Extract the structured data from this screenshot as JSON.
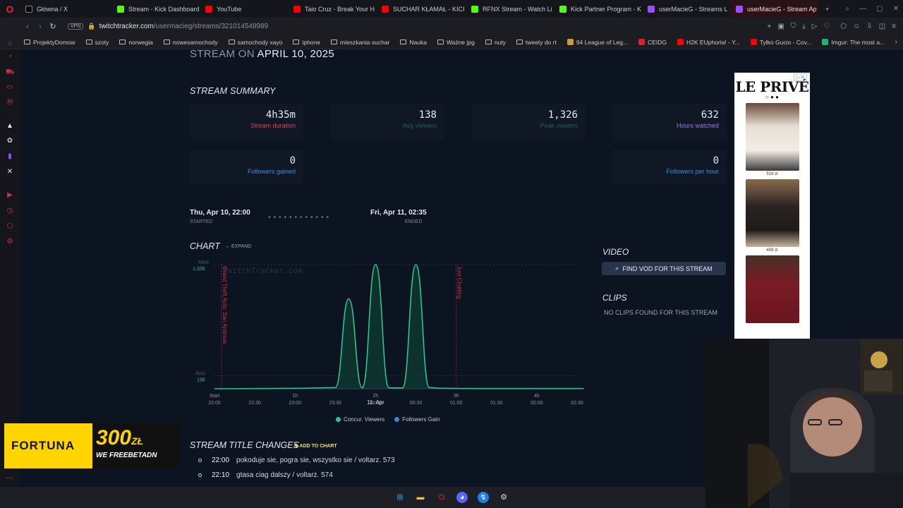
{
  "browser": {
    "tabs": [
      {
        "label": "Główna / X",
        "color": "#ffffff"
      },
      {
        "label": "Stream - Kick Dashboard",
        "color": "#53fc18"
      },
      {
        "label": "YouTube",
        "color": "#ff0000"
      },
      {
        "label": "Taio Cruz - Break Your H",
        "color": "#ff0000"
      },
      {
        "label": "SUCHAR KŁAMAŁ - KICI",
        "color": "#ff0000"
      },
      {
        "label": "RFNX Stream - Watch Li",
        "color": "#53fc18"
      },
      {
        "label": "Kick Partner Program - K",
        "color": "#53fc18"
      },
      {
        "label": "userMacieG - Streams L",
        "color": "#9b4dff"
      },
      {
        "label": "userMacieG - Stream Ap",
        "color": "#9b4dff"
      }
    ],
    "url_host": "twitchtracker.com",
    "url_path": "/usermacieg/streams/321014548989",
    "vpn_label": "VPN",
    "bookmarks": [
      {
        "label": "ProjektyDomow",
        "icon": "folder"
      },
      {
        "label": "szoty",
        "icon": "folder"
      },
      {
        "label": "norwegia",
        "icon": "folder"
      },
      {
        "label": "nowesamochody",
        "icon": "folder"
      },
      {
        "label": "samochody xayo",
        "icon": "folder"
      },
      {
        "label": "iphone",
        "icon": "folder"
      },
      {
        "label": "mieszkania suchar",
        "icon": "folder"
      },
      {
        "label": "Nauka",
        "icon": "folder"
      },
      {
        "label": "Ważne jpg",
        "icon": "folder"
      },
      {
        "label": "nuty",
        "icon": "folder"
      },
      {
        "label": "tweety do rt",
        "icon": "folder"
      },
      {
        "label": "94 League of Leg...",
        "icon": "site"
      },
      {
        "label": "CEIDG",
        "icon": "site"
      },
      {
        "label": "H2K EUphoria! - Y...",
        "icon": "site"
      },
      {
        "label": "Tylko Gucio - Cov...",
        "icon": "site"
      },
      {
        "label": "Imgur: The most a...",
        "icon": "site"
      }
    ]
  },
  "page": {
    "stream_on_prefix": "STREAM ON",
    "stream_on_date": "APRIL 10, 2025",
    "summary_title": "STREAM SUMMARY",
    "stats": [
      {
        "value": "4h35m",
        "label": "Stream duration",
        "color": "#e2434b"
      },
      {
        "value": "138",
        "label": "Avg viewers",
        "color": "#1f5f4a"
      },
      {
        "value": "1,326",
        "label": "Peak viewers",
        "color": "#1f5f4a"
      },
      {
        "value": "632",
        "label": "Hours watched",
        "color": "#9a7be0"
      },
      {
        "value": "0",
        "label": "Followers gained",
        "color": "#3b8fd6"
      },
      {
        "value": "0",
        "label": "Followers per hour",
        "color": "#3b8fd6"
      }
    ],
    "timeline": {
      "start": "Thu, Apr 10, 22:00",
      "start_label": "STARTED",
      "end": "Fri, Apr 11, 02:35",
      "end_label": "ENDED",
      "dots": "••••••••••••"
    },
    "chart_title": "CHART",
    "expand_label": "↔ EXPAND",
    "video_title": "VIDEO",
    "find_vod": "FIND VOD FOR THIS STREAM",
    "clips_title": "CLIPS",
    "no_clips": "NO CLIPS FOUND FOR THIS STREAM",
    "title_changes_title": "STREAM TITLE CHANGES",
    "add_to_chart": "✚ ADD TO CHART",
    "title_changes": [
      {
        "time": "22:00",
        "text": "pokoduje sie, pogra sie, wszystko sie / voltarz. 573"
      },
      {
        "time": "22:10",
        "text": "gtasa ciag dalszy / voltarz. 574"
      }
    ]
  },
  "chart_data": {
    "type": "line",
    "x_ticks": [
      "22:00",
      "22:30",
      "23:00",
      "23:30",
      "00:00",
      "00:30",
      "01:00",
      "01:30",
      "02:00",
      "02:30"
    ],
    "x_top_ticks": [
      "Start",
      "1h",
      "2h",
      "3h",
      "4h"
    ],
    "date_marker": "11. Apr",
    "max_label": "MAX",
    "max_value": 1326,
    "avg_label": "AVG",
    "avg_value": 138,
    "watermark": "TwitchTracker.com",
    "game_markers": [
      {
        "label": "Grand Theft Auto: San Andreas",
        "time": "22:00"
      },
      {
        "label": "Just Chatting",
        "time": "01:00"
      }
    ],
    "series": [
      {
        "name": "Concur. Viewers",
        "color": "#2fc38d",
        "x": [
          "22:00",
          "22:30",
          "23:00",
          "23:30",
          "23:40",
          "23:50",
          "00:00",
          "00:10",
          "00:20",
          "00:30",
          "00:40",
          "00:50",
          "01:00",
          "01:30",
          "02:00",
          "02:35"
        ],
        "values": [
          0,
          2,
          5,
          12,
          960,
          10,
          1326,
          10,
          8,
          1326,
          12,
          5,
          3,
          2,
          2,
          2
        ]
      },
      {
        "name": "Followers Gain",
        "color": "#2f8fd6",
        "values": []
      }
    ],
    "ylim": [
      0,
      1326
    ]
  },
  "ad": {
    "brand": "LE PRIVÉ",
    "dots": "○ ● ●",
    "prices": [
      "519 zł",
      "409 zł",
      ""
    ],
    "close": "▷✕"
  },
  "fortuna": {
    "brand": "FORTUNA",
    "amount": "300",
    "currency": "ZŁ",
    "code": "WE FREEBETADN"
  }
}
